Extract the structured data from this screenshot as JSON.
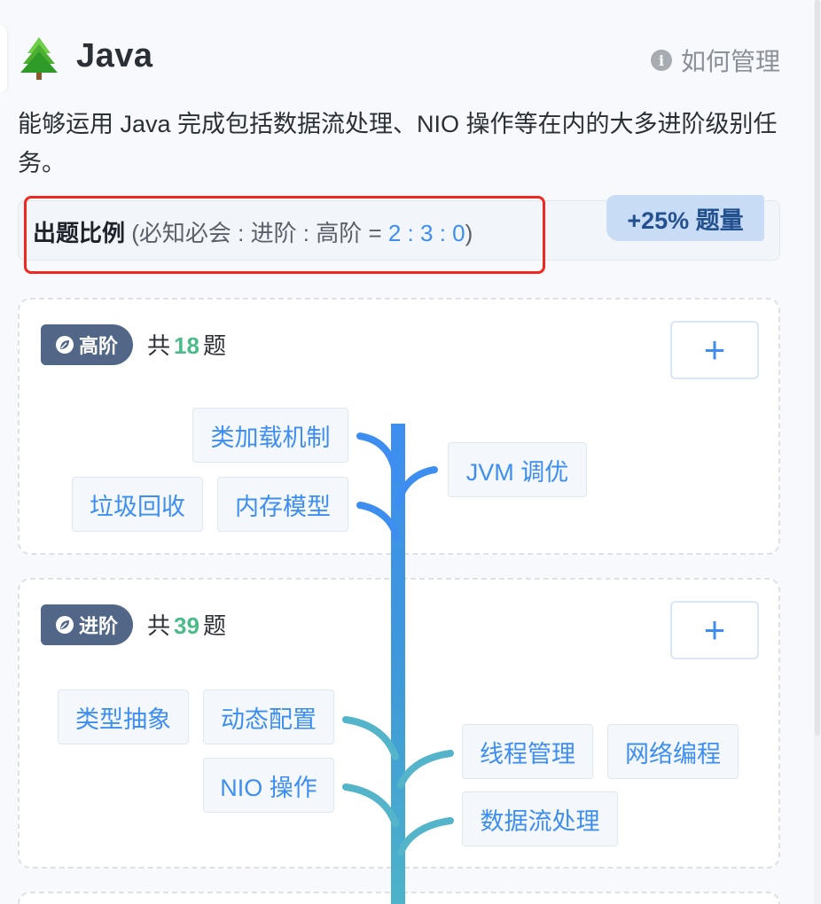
{
  "header": {
    "title": "Java",
    "howto_label": "如何管理",
    "icon": "tree-icon"
  },
  "description": "能够运用 Java 完成包括数据流处理、NIO 操作等在内的大多进阶级别任务。",
  "ratio": {
    "label": "出题比例",
    "formula": " (必知必会 : 进阶 : 高阶 = ",
    "numbers": "2 : 3 : 0",
    "close": ")",
    "badge": "+25% 题量"
  },
  "sections": {
    "high": {
      "level": "高阶",
      "count_prefix": "共",
      "count": "18",
      "count_suffix": "题",
      "add": "+",
      "topics": [
        "类加载机制",
        "垃圾回收",
        "内存模型",
        "JVM 调优"
      ]
    },
    "mid": {
      "level": "进阶",
      "count_prefix": "共",
      "count": "39",
      "count_suffix": "题",
      "add": "+",
      "topics": [
        "类型抽象",
        "动态配置",
        "NIO 操作",
        "线程管理",
        "网络编程",
        "数据流处理"
      ]
    }
  },
  "colors": {
    "accent": "#3d8ef0",
    "count_green": "#4cbb8a",
    "tag_bg": "#526688",
    "highlight_red": "#ee2a20"
  }
}
